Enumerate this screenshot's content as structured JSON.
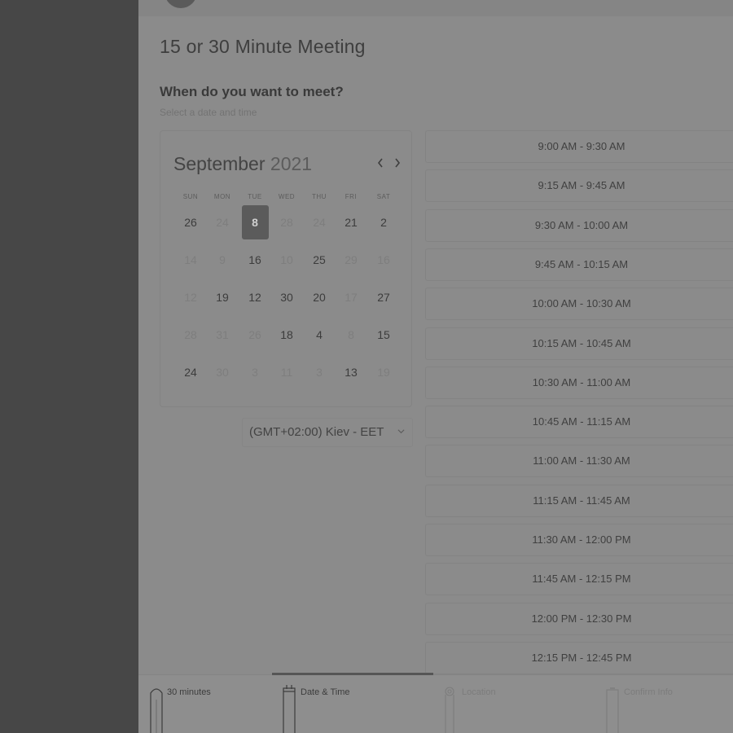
{
  "page": {
    "title": "15 or 30 Minute Meeting",
    "section_heading": "When do you want to meet?",
    "section_sub": "Select a date and time"
  },
  "calendar": {
    "month": "September",
    "year": "2021",
    "weekdays": [
      "SUN",
      "MON",
      "TUE",
      "WED",
      "THU",
      "FRI",
      "SAT"
    ],
    "weeks": [
      [
        {
          "d": "26",
          "a": true
        },
        {
          "d": "24",
          "a": false
        },
        {
          "d": "8",
          "a": true,
          "sel": true
        },
        {
          "d": "28",
          "a": false
        },
        {
          "d": "24",
          "a": false
        },
        {
          "d": "21",
          "a": true
        },
        {
          "d": "2",
          "a": true
        }
      ],
      [
        {
          "d": "14",
          "a": false
        },
        {
          "d": "9",
          "a": false
        },
        {
          "d": "16",
          "a": true
        },
        {
          "d": "10",
          "a": false
        },
        {
          "d": "25",
          "a": true
        },
        {
          "d": "29",
          "a": false
        },
        {
          "d": "16",
          "a": false
        }
      ],
      [
        {
          "d": "12",
          "a": false
        },
        {
          "d": "19",
          "a": true
        },
        {
          "d": "12",
          "a": true
        },
        {
          "d": "30",
          "a": true
        },
        {
          "d": "20",
          "a": true
        },
        {
          "d": "17",
          "a": false
        },
        {
          "d": "27",
          "a": true
        }
      ],
      [
        {
          "d": "28",
          "a": false
        },
        {
          "d": "31",
          "a": false
        },
        {
          "d": "26",
          "a": false
        },
        {
          "d": "18",
          "a": true
        },
        {
          "d": "4",
          "a": true
        },
        {
          "d": "8",
          "a": false
        },
        {
          "d": "15",
          "a": true
        }
      ],
      [
        {
          "d": "24",
          "a": true
        },
        {
          "d": "30",
          "a": false
        },
        {
          "d": "3",
          "a": false
        },
        {
          "d": "11",
          "a": false
        },
        {
          "d": "3",
          "a": false
        },
        {
          "d": "13",
          "a": true
        },
        {
          "d": "19",
          "a": false
        }
      ]
    ],
    "prev_icon": "chevron-left-icon",
    "next_icon": "chevron-right-icon"
  },
  "timezone": {
    "value": "(GMT+02:00) Kiev - EET",
    "icon": "chevron-down-icon"
  },
  "time_slots": [
    "9:00 AM - 9:30 AM",
    "9:15 AM - 9:45 AM",
    "9:30 AM - 10:00 AM",
    "9:45 AM - 10:15 AM",
    "10:00 AM - 10:30 AM",
    "10:15 AM - 10:45 AM",
    "10:30 AM - 11:00 AM",
    "10:45 AM - 11:15 AM",
    "11:00 AM - 11:30 AM",
    "11:15 AM - 11:45 AM",
    "11:30 AM - 12:00 PM",
    "11:45 AM - 12:15 PM",
    "12:00 PM - 12:30 PM",
    "12:15 PM - 12:45 PM"
  ],
  "steps": [
    {
      "label": "30 minutes",
      "icon": "hourglass-icon",
      "state": "done"
    },
    {
      "label": "Date & Time",
      "icon": "calendar-icon",
      "state": "active"
    },
    {
      "label": "Location",
      "icon": "location-pin-icon",
      "state": "pending"
    },
    {
      "label": "Confirm Info",
      "icon": "clipboard-icon",
      "state": "pending"
    }
  ],
  "colors": {
    "overlay_gray": "#8b8b8b",
    "sidebar": "#474747",
    "selected_day": "#5b5b5b"
  }
}
